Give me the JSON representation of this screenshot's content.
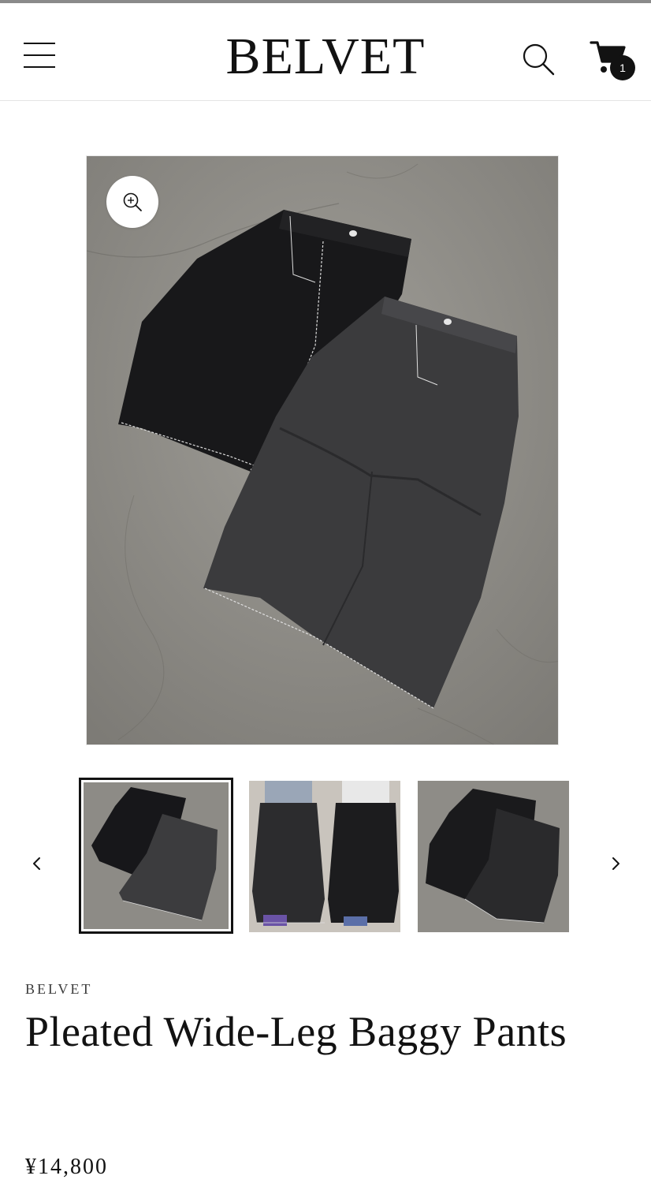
{
  "header": {
    "logo": "BELVET",
    "menu_icon": "hamburger-menu-icon",
    "search_icon": "search-icon",
    "cart_icon": "cart-icon",
    "cart_count": "1"
  },
  "product": {
    "main_image_alt": "Pleated Wide-Leg Baggy Pants",
    "thumbnails": [
      {
        "alt": "Two pairs of pants flat lay"
      },
      {
        "alt": "Two models wearing pants"
      },
      {
        "alt": "Pants flat lay close-up"
      }
    ],
    "vendor": "BELVET",
    "title": "Pleated Wide-Leg Baggy Pants",
    "price": "¥14,800"
  },
  "colors": {
    "text": "#121212",
    "concrete": "#8e8c87",
    "denim_black": "#1b1b1d",
    "denim_grey": "#3a3a3c"
  }
}
